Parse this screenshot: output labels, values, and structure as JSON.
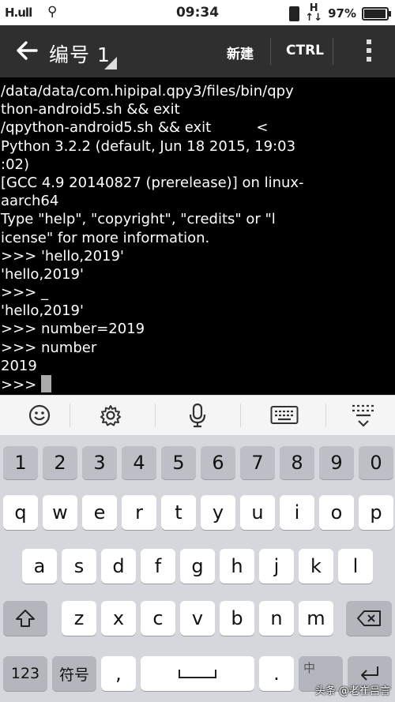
{
  "status": {
    "signal": "H.ull",
    "time": "09:34",
    "network": "H",
    "battery": "97%",
    "battery_level": 0.97
  },
  "appbar": {
    "title": "编号 1",
    "new_label": "新建",
    "ctrl_label": "CTRL"
  },
  "terminal": {
    "lines": [
      "/data/data/com.hipipal.qpy3/files/bin/qpy",
      "thon-android5.sh && exit",
      "/qpython-android5.sh && exit          <",
      "Python 3.2.2 (default, Jun 18 2015, 19:03",
      ":02)",
      "[GCC 4.9 20140827 (prerelease)] on linux-",
      "aarch64",
      "Type \"help\", \"copyright\", \"credits\" or \"l",
      "icense\" for more information.",
      ">>> 'hello,2019'",
      "'hello,2019'",
      ">>> _",
      "'hello,2019'",
      ">>> number=2019",
      ">>> number",
      "2019"
    ],
    "prompt": ">>>"
  },
  "keyboard": {
    "numbers": [
      "1",
      "2",
      "3",
      "4",
      "5",
      "6",
      "7",
      "8",
      "9",
      "0"
    ],
    "row1": [
      "q",
      "w",
      "e",
      "r",
      "t",
      "y",
      "u",
      "i",
      "o",
      "p"
    ],
    "row2": [
      "a",
      "s",
      "d",
      "f",
      "g",
      "h",
      "j",
      "k",
      "l"
    ],
    "row3": [
      "z",
      "x",
      "c",
      "v",
      "b",
      "n",
      "m"
    ],
    "key_123": "123",
    "key_symbols": "符号",
    "key_comma": ",",
    "key_period": ".",
    "key_lang": "中"
  },
  "watermark": "头条 @老崔吕言"
}
